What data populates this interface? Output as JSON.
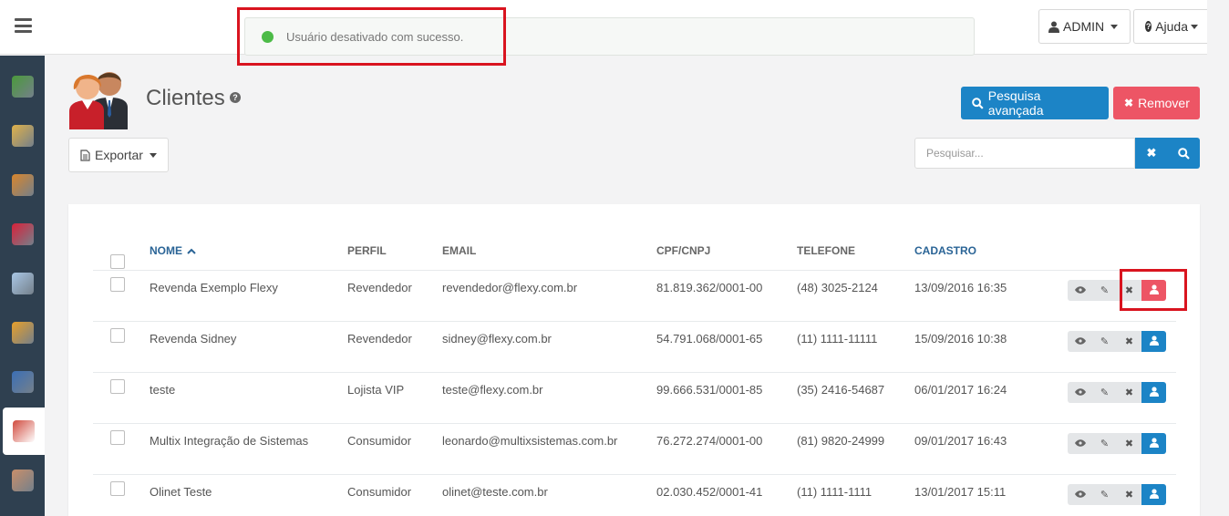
{
  "topbar": {
    "toast_message": "Usuário desativado com sucesso.",
    "admin_label": "ADMIN",
    "help_label": "Ajuda"
  },
  "sidebar": {
    "items": [
      {
        "icon": "database-icon",
        "color": "#4a9a3b"
      },
      {
        "icon": "store-icon",
        "color": "#e0b24a"
      },
      {
        "icon": "boxes-icon",
        "color": "#d9862c"
      },
      {
        "icon": "discount-icon",
        "color": "#d9213a"
      },
      {
        "icon": "payment-card-icon",
        "color": "#a9c7e6"
      },
      {
        "icon": "delivery-truck-icon",
        "color": "#e8a02a"
      },
      {
        "icon": "document-icon",
        "color": "#3b6fb6"
      },
      {
        "icon": "clients-icon",
        "color": "#d04a3d",
        "active": true
      },
      {
        "icon": "user-icon",
        "color": "#c98f6a"
      }
    ]
  },
  "page": {
    "title": "Clientes",
    "advanced_search_label": "Pesquisa avançada",
    "remove_label": "Remover",
    "export_label": "Exportar",
    "search_placeholder": "Pesquisar..."
  },
  "table": {
    "headers": {
      "nome": "NOME",
      "perfil": "PERFIL",
      "email": "EMAIL",
      "cpf": "CPF/CNPJ",
      "telefone": "TELEFONE",
      "cadastro": "CADASTRO"
    },
    "rows": [
      {
        "nome": "Revenda Exemplo Flexy",
        "perfil": "Revendedor",
        "email": "revendedor@flexy.com.br",
        "cpf": "81.819.362/0001-00",
        "telefone": "(48) 3025-2124",
        "cadastro": "13/09/2016 16:35",
        "disabled": true
      },
      {
        "nome": "Revenda Sidney",
        "perfil": "Revendedor",
        "email": "sidney@flexy.com.br",
        "cpf": "54.791.068/0001-65",
        "telefone": "(11) 1111-11111",
        "cadastro": "15/09/2016 10:38",
        "disabled": false
      },
      {
        "nome": "teste",
        "perfil": "Lojista VIP",
        "email": "teste@flexy.com.br",
        "cpf": "99.666.531/0001-85",
        "telefone": "(35) 2416-54687",
        "cadastro": "06/01/2017 16:24",
        "disabled": false
      },
      {
        "nome": "Multix Integração de Sistemas",
        "perfil": "Consumidor",
        "email": "leonardo@multixsistemas.com.br",
        "cpf": "76.272.274/0001-00",
        "telefone": "(81) 9820-24999",
        "cadastro": "09/01/2017 16:43",
        "disabled": false
      },
      {
        "nome": "Olinet Teste",
        "perfil": "Consumidor",
        "email": "olinet@teste.com.br",
        "cpf": "02.030.452/0001-41",
        "telefone": "(11) 1111-1111",
        "cadastro": "13/01/2017 15:11",
        "disabled": false
      }
    ]
  },
  "colors": {
    "primary": "#1c84c6",
    "danger": "#ed5565",
    "success": "#4cbb47",
    "sidebar": "#2f4050",
    "highlight": "#d9141f"
  }
}
